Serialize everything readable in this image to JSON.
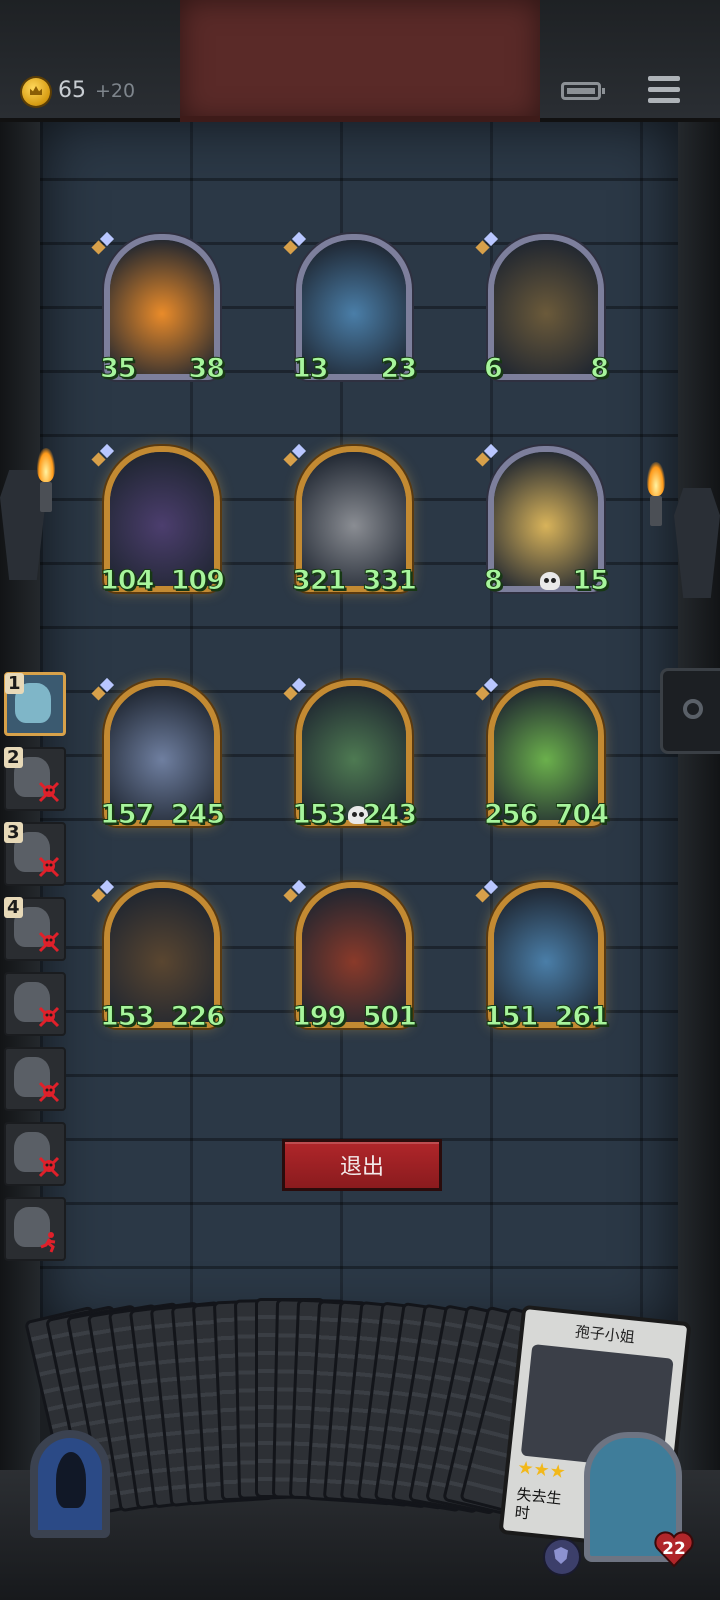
{
  "topbar": {
    "coins": "65",
    "coin_bonus": "+20"
  },
  "board": {
    "rows": [
      [
        {
          "name": "pumpkin-ghost",
          "atk": "35",
          "hp": "38",
          "frame": "silver",
          "color": "#e98b2a"
        },
        {
          "name": "elf-sorceress",
          "atk": "13",
          "hp": "23",
          "frame": "silver",
          "color": "#4a7ea8"
        },
        {
          "name": "goblin-shaman",
          "atk": "6",
          "hp": "8",
          "frame": "silver",
          "color": "#6b5a3a"
        }
      ],
      [
        {
          "name": "hooded-brute",
          "atk": "104",
          "hp": "109",
          "frame": "gold",
          "color": "#4c3e6e"
        },
        {
          "name": "armored-knight",
          "atk": "321",
          "hp": "331",
          "frame": "gold",
          "color": "#8a8d93"
        },
        {
          "name": "puppet-boy",
          "atk": "8",
          "hp": "15",
          "frame": "silver",
          "color": "#d8b35a"
        }
      ],
      [
        {
          "name": "spore-mushroom",
          "atk": "157",
          "hp": "245",
          "frame": "gold",
          "color": "#6f7fa0"
        },
        {
          "name": "vine-sprout",
          "atk": "153",
          "hp": "243",
          "frame": "gold",
          "color": "#4e7a52"
        },
        {
          "name": "leaf-girl",
          "atk": "256",
          "hp": "704",
          "frame": "gold",
          "color": "#6bb04c"
        }
      ],
      [
        {
          "name": "treant",
          "atk": "153",
          "hp": "226",
          "frame": "gold",
          "color": "#5a4630"
        },
        {
          "name": "fire-dragon",
          "atk": "199",
          "hp": "501",
          "frame": "gold",
          "color": "#8a3a2a"
        },
        {
          "name": "elf-sorceress-elite",
          "atk": "151",
          "hp": "261",
          "frame": "gold",
          "color": "#4a7ea8"
        }
      ]
    ]
  },
  "roster": [
    {
      "num": "1",
      "state": "active"
    },
    {
      "num": "2",
      "state": "dead"
    },
    {
      "num": "3",
      "state": "dead"
    },
    {
      "num": "4",
      "state": "dead"
    },
    {
      "num": "",
      "state": "dead"
    },
    {
      "num": "",
      "state": "dead"
    },
    {
      "num": "",
      "state": "dead"
    },
    {
      "num": "",
      "state": "fled"
    }
  ],
  "exit_label": "退出",
  "featured_card": {
    "name": "孢子小姐",
    "stars": "★★★",
    "desc": "失去生时"
  },
  "hero": {
    "health": "22"
  },
  "colors": {
    "stat_green": "#a7f59c",
    "exit_red": "#b0262a",
    "gold_frame": "#c38a32"
  }
}
